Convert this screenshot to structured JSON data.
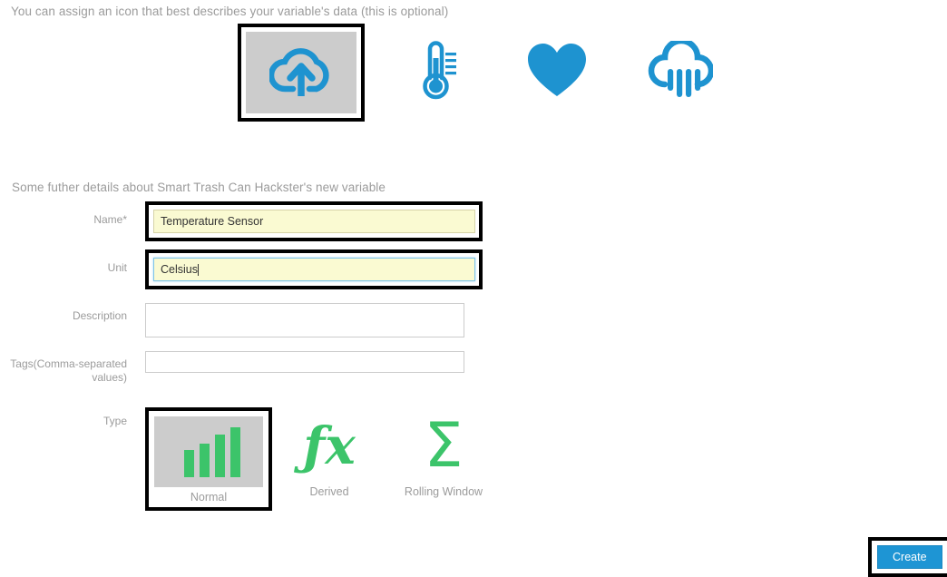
{
  "icon_section": {
    "help_text": "You can assign an icon that best describes your variable's data (this is optional)",
    "selected_index": 0,
    "accent_color": "#1e93d0",
    "selection_border_color": "#000000",
    "selected_bg_color": "#cccccc",
    "options": [
      {
        "name": "cloud-upload-icon",
        "label": "Cloud Upload",
        "selected": true
      },
      {
        "name": "thermometer-icon",
        "label": "Thermometer",
        "selected": false
      },
      {
        "name": "heart-icon",
        "label": "Heart",
        "selected": false
      },
      {
        "name": "rain-cloud-icon",
        "label": "Rain Cloud",
        "selected": false
      }
    ]
  },
  "details_section": {
    "caption": "Some futher details about Smart Trash Can Hackster's new variable",
    "fields": [
      {
        "label": "Name*",
        "value": "Temperature Sensor",
        "placeholder": "",
        "state": "autofilled",
        "highlighted": true,
        "focused": false
      },
      {
        "label": "Unit",
        "value": "Celsius",
        "placeholder": "",
        "state": "autofilled",
        "highlighted": true,
        "focused": true
      },
      {
        "label": "Description",
        "value": "",
        "placeholder": "",
        "state": "empty",
        "highlighted": false,
        "focused": false
      },
      {
        "label": "Tags(Comma-separated values)",
        "value": "",
        "placeholder": "",
        "state": "empty",
        "highlighted": false,
        "focused": false
      }
    ],
    "autofill_color": "#fafad2",
    "focus_border_color": "#7ec4e8"
  },
  "type_section": {
    "label": "Type",
    "accent_color": "#3cc46a",
    "selected_index": 0,
    "options": [
      {
        "name": "normal-type",
        "label": "Normal",
        "icon": "bar-chart-icon",
        "selected": true
      },
      {
        "name": "derived-type",
        "label": "Derived",
        "icon": "fx-icon",
        "selected": false
      },
      {
        "name": "rolling-window-type",
        "label": "Rolling Window",
        "icon": "sigma-icon",
        "selected": false
      }
    ],
    "bar_chart": {
      "bars": [
        38,
        52,
        70,
        86
      ],
      "bar_color": "#3cc46a"
    }
  },
  "footer": {
    "create_label": "Create",
    "create_color": "#1e95d4"
  }
}
